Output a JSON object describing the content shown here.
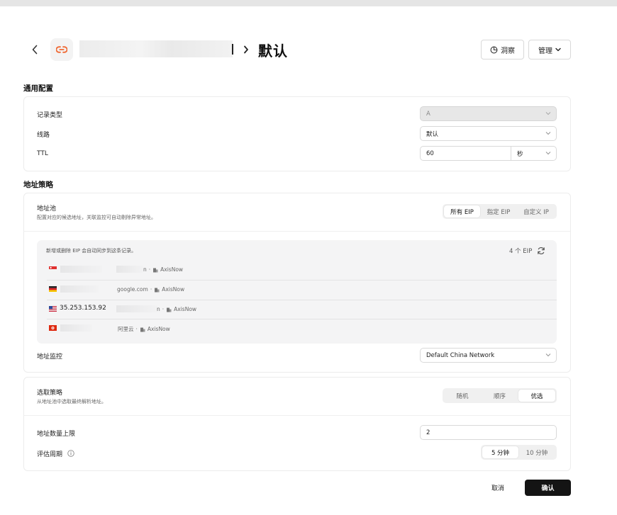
{
  "header": {
    "title": "默认",
    "insight_label": "洞察",
    "manage_label": "管理"
  },
  "general": {
    "section_title": "通用配置",
    "record_type_label": "记录类型",
    "record_type_value": "A",
    "line_label": "线路",
    "line_value": "默认",
    "ttl_label": "TTL",
    "ttl_value": "60",
    "ttl_unit": "秒"
  },
  "address_policy": {
    "section_title": "地址策略",
    "pool_label": "地址池",
    "pool_desc": "配置对应的候选地址，关联监控可自动剔除异常地址。",
    "pool_tabs": [
      {
        "label": "所有 EIP",
        "active": true
      },
      {
        "label": "指定 EIP",
        "active": false
      },
      {
        "label": "自定义 IP",
        "active": false
      }
    ],
    "pool_note": "新增或删除 EIP 会自动同步到这条记录。",
    "pool_count": "4 个 EIP",
    "eips": [
      {
        "flag": "sg",
        "ip": "",
        "provider_suffix": "n",
        "project": "AxisNow"
      },
      {
        "flag": "de",
        "ip": "",
        "provider_suffix": "google.com",
        "project": "AxisNow"
      },
      {
        "flag": "us",
        "ip": "35.253.153.92",
        "provider_suffix": "n",
        "project": "AxisNow"
      },
      {
        "flag": "hk",
        "ip": "",
        "provider_suffix": "阿里云",
        "project": "AxisNow"
      }
    ],
    "monitor_label": "地址监控",
    "monitor_value": "Default China Network"
  },
  "selection": {
    "label": "选取策略",
    "desc": "从地址池中选取最终解析地址。",
    "tabs": [
      {
        "label": "随机",
        "active": false
      },
      {
        "label": "顺序",
        "active": false
      },
      {
        "label": "优选",
        "active": true
      }
    ],
    "max_label": "地址数量上限",
    "max_value": "2",
    "period_label": "评估周期",
    "period_tabs": [
      {
        "label": "5 分钟",
        "active": true
      },
      {
        "label": "10 分钟",
        "active": false
      }
    ]
  },
  "footer": {
    "cancel_label": "取消",
    "confirm_label": "确认"
  },
  "colors": {
    "accent_logo": "#f06a35",
    "confirm_bg": "#141414"
  }
}
